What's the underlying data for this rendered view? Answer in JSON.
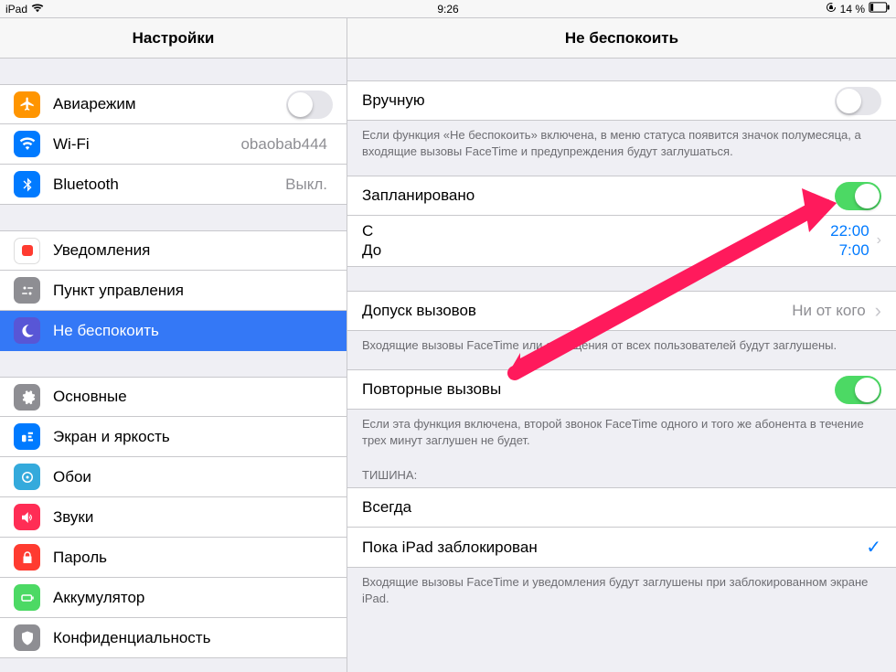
{
  "status": {
    "device": "iPad",
    "time": "9:26",
    "battery_text": "14 %"
  },
  "sidebar": {
    "title": "Настройки",
    "items": [
      {
        "key": "airplane",
        "label": "Авиарежим",
        "toggle": false,
        "color": "#ff9500"
      },
      {
        "key": "wifi",
        "label": "Wi-Fi",
        "value": "obaobab444",
        "color": "#007aff"
      },
      {
        "key": "bluetooth",
        "label": "Bluetooth",
        "value": "Выкл.",
        "color": "#007aff"
      },
      {
        "key": "notif",
        "label": "Уведомления",
        "color": "#ff3b30"
      },
      {
        "key": "control",
        "label": "Пункт управления",
        "color": "#8e8e93"
      },
      {
        "key": "dnd",
        "label": "Не беспокоить",
        "color": "#5856d6",
        "selected": true
      },
      {
        "key": "general",
        "label": "Основные",
        "color": "#8e8e93"
      },
      {
        "key": "display",
        "label": "Экран и яркость",
        "color": "#007aff"
      },
      {
        "key": "wallpaper",
        "label": "Обои",
        "color": "#34aadc"
      },
      {
        "key": "sounds",
        "label": "Звуки",
        "color": "#ff2d55"
      },
      {
        "key": "passcode",
        "label": "Пароль",
        "color": "#ff3b30"
      },
      {
        "key": "battery",
        "label": "Аккумулятор",
        "color": "#4cd964"
      },
      {
        "key": "privacy",
        "label": "Конфиденциальность",
        "color": "#8e8e93"
      }
    ]
  },
  "detail": {
    "title": "Не беспокоить",
    "manual_label": "Вручную",
    "manual_on": false,
    "manual_note": "Если функция «Не беспокоить» включена, в меню статуса появится значок полумесяца, а входящие вызовы FaceTime и предупреждения будут заглушаться.",
    "scheduled_label": "Запланировано",
    "scheduled_on": true,
    "from_label": "С",
    "to_label": "До",
    "from_time": "22:00",
    "to_time": "7:00",
    "allow_calls_label": "Допуск вызовов",
    "allow_calls_value": "Ни от кого",
    "allow_calls_note": "Входящие вызовы FaceTime или сообщения от всех пользователей будут заглушены.",
    "repeated_label": "Повторные вызовы",
    "repeated_on": true,
    "repeated_note": "Если эта функция включена, второй звонок FaceTime одного и того же абонента в течение трех минут заглушен не будет.",
    "silence_header": "ТИШИНА:",
    "silence_always": "Всегда",
    "silence_locked": "Пока iPad заблокирован",
    "silence_note": "Входящие вызовы FaceTime и уведомления будут заглушены при заблокированном экране iPad."
  }
}
